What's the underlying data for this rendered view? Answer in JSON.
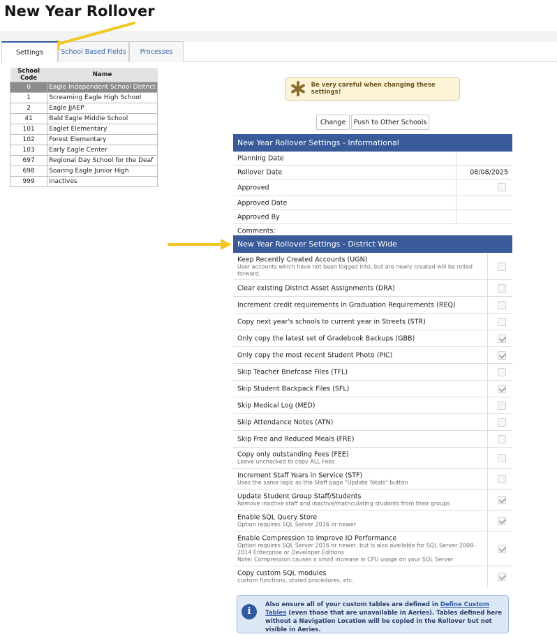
{
  "page": {
    "title": "New Year Rollover"
  },
  "tabs": [
    "Settings",
    "School Based Fields",
    "Processes"
  ],
  "schools": {
    "headers": {
      "code": "School Code",
      "name": "Name"
    },
    "rows": [
      {
        "code": "0",
        "name": "Eagle Independent School District"
      },
      {
        "code": "1",
        "name": "Screaming Eagle High School"
      },
      {
        "code": "2",
        "name": "Eagle JJAEP"
      },
      {
        "code": "41",
        "name": "Bald Eagle Middle School"
      },
      {
        "code": "101",
        "name": "Eaglet Elementary"
      },
      {
        "code": "102",
        "name": "Forest Elementary"
      },
      {
        "code": "103",
        "name": "Early Eagle Center"
      },
      {
        "code": "697",
        "name": "Regional Day School for the Deaf"
      },
      {
        "code": "698",
        "name": "Soaring Eagle Junior High"
      },
      {
        "code": "999",
        "name": "Inactives"
      }
    ]
  },
  "warning": {
    "text": "Be very careful when changing these settings!",
    "icon": "asterisk-icon",
    "icon_color": "#8a6d2c"
  },
  "buttons": {
    "change": "Change",
    "push": "Push to Other Schools"
  },
  "informational": {
    "header": "New Year Rollover Settings - Informational",
    "rows": [
      {
        "label": "Planning Date",
        "value": ""
      },
      {
        "label": "Rollover Date",
        "value": "08/08/2025"
      },
      {
        "label": "Approved",
        "value": ""
      },
      {
        "label": "Approved Date",
        "value": ""
      },
      {
        "label": "Approved By",
        "value": ""
      },
      {
        "label": "Comments:",
        "value": ""
      }
    ],
    "approved_checked": false
  },
  "district_wide": {
    "header": "New Year Rollover Settings - District Wide",
    "rows": [
      {
        "label": "Keep Recently Created Accounts (UGN)",
        "desc": "User accounts which have not been logged into, but are newly created will be rolled forward.",
        "checked": false
      },
      {
        "label": "Clear existing District Asset Assignments (DRA)",
        "desc": "",
        "checked": false
      },
      {
        "label": "Increment credit requirements in Graduation Requirements (REQ)",
        "desc": "",
        "checked": false
      },
      {
        "label": "Copy next year's schools to current year in Streets (STR)",
        "desc": "",
        "checked": false
      },
      {
        "label": "Only copy the latest set of Gradebook Backups (GBB)",
        "desc": "",
        "checked": true
      },
      {
        "label": "Only copy the most recent Student Photo (PIC)",
        "desc": "",
        "checked": true
      },
      {
        "label": "Skip Teacher Briefcase Files (TFL)",
        "desc": "",
        "checked": false
      },
      {
        "label": "Skip Student Backpack Files (SFL)",
        "desc": "",
        "checked": true
      },
      {
        "label": "Skip Medical Log (MED)",
        "desc": "",
        "checked": false
      },
      {
        "label": "Skip Attendance Notes (ATN)",
        "desc": "",
        "checked": false
      },
      {
        "label": "Skip Free and Reduced Meals (FRE)",
        "desc": "",
        "checked": false
      },
      {
        "label": "Copy only outstanding Fees (FEE)",
        "desc": "Leave unchecked to copy ALL Fees",
        "checked": false
      },
      {
        "label": "Increment Staff Years in Service (STF)",
        "desc": "Uses the same logic as the Staff page \"Update Totals\" button",
        "checked": false
      },
      {
        "label": "Update Student Group Staff/Students",
        "desc": "Remove inactive staff and inactive/matriculating students from their groups",
        "checked": true
      },
      {
        "label": "Enable SQL Query Store",
        "desc": "Option requires SQL Server 2016 or newer",
        "checked": true
      },
      {
        "label": "Enable Compression to Improve IO Performance",
        "desc": "Option requires SQL Server 2016 or newer, but is also available for SQL Server 2008-2014 Enterprise or Developer Editions",
        "desc2": "Note: Compression causes a small increase in CPU usage on your SQL Server",
        "checked": true
      },
      {
        "label": "Copy custom SQL modules",
        "desc": "custom functions, stored procedures, etc.",
        "checked": true
      }
    ]
  },
  "note": {
    "before": "Also ensure all of your custom tables are defined in ",
    "link": "Define Custom Tables",
    "after": " (even those that are unavailable in Aeries). Tables defined here without a Navigation Location will be copied in the Rollover but not visible in Aeries.",
    "icon": "info-icon"
  },
  "colors": {
    "header_bg": "#3a5b9a",
    "accent": "#2f5aa0",
    "annotation_arrow": "#f3c623"
  }
}
